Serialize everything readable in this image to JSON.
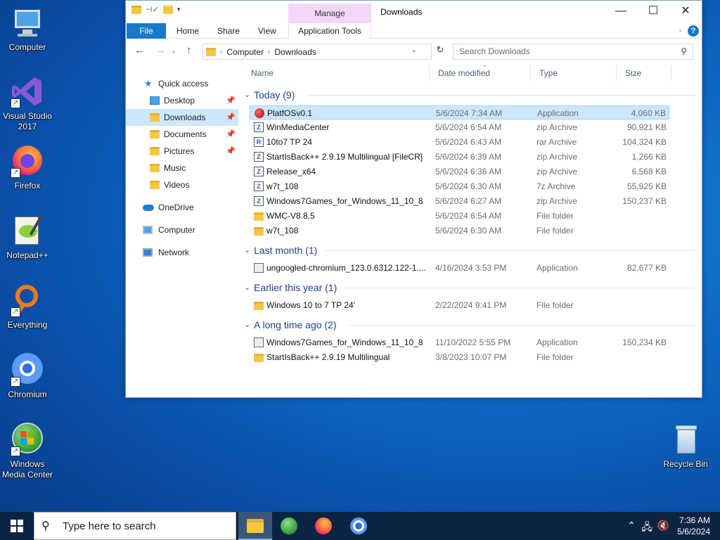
{
  "desktop": {
    "icons": [
      {
        "label": "Computer"
      },
      {
        "label": "Visual Studio 2017"
      },
      {
        "label": "Firefox"
      },
      {
        "label": "Notepad++"
      },
      {
        "label": "Everything"
      },
      {
        "label": "Chromium"
      },
      {
        "label": "Windows Media Center"
      },
      {
        "label": "Recycle Bin"
      }
    ]
  },
  "window": {
    "title": "Downloads",
    "manage_label": "Manage",
    "ribbon_tabs": {
      "file": "File",
      "home": "Home",
      "share": "Share",
      "view": "View",
      "app_tools": "Application Tools"
    },
    "address": {
      "seg1": "Computer",
      "seg2": "Downloads"
    },
    "search_placeholder": "Search Downloads",
    "nav": {
      "quick_access": "Quick access",
      "desktop": "Desktop",
      "downloads": "Downloads",
      "documents": "Documents",
      "pictures": "Pictures",
      "music": "Music",
      "videos": "Videos",
      "onedrive": "OneDrive",
      "computer": "Computer",
      "network": "Network"
    },
    "columns": {
      "name": "Name",
      "date": "Date modified",
      "type": "Type",
      "size": "Size"
    },
    "groups": [
      {
        "title": "Today (9)",
        "rows": [
          {
            "name": "PlatfOSv0.1",
            "date": "5/6/2024 7:34 AM",
            "type": "Application",
            "size": "4,060 KB"
          },
          {
            "name": "WinMediaCenter",
            "date": "5/6/2024 6:54 AM",
            "type": "zip Archive",
            "size": "90,921 KB"
          },
          {
            "name": "10to7 TP 24",
            "date": "5/6/2024 6:43 AM",
            "type": "rar Archive",
            "size": "104,324 KB"
          },
          {
            "name": "StartIsBack++ 2.9.19 Multilingual [FileCR]",
            "date": "5/6/2024 6:39 AM",
            "type": "zip Archive",
            "size": "1,266 KB"
          },
          {
            "name": "Release_x64",
            "date": "5/6/2024 6:36 AM",
            "type": "zip Archive",
            "size": "6,568 KB"
          },
          {
            "name": "w7t_108",
            "date": "5/6/2024 6:30 AM",
            "type": "7z Archive",
            "size": "55,925 KB"
          },
          {
            "name": "Windows7Games_for_Windows_11_10_8",
            "date": "5/6/2024 6:27 AM",
            "type": "zip Archive",
            "size": "150,237 KB"
          },
          {
            "name": "WMC-V8.8.5",
            "date": "5/6/2024 6:54 AM",
            "type": "File folder",
            "size": ""
          },
          {
            "name": "w7t_108",
            "date": "5/6/2024 6:30 AM",
            "type": "File folder",
            "size": ""
          }
        ]
      },
      {
        "title": "Last month (1)",
        "rows": [
          {
            "name": "ungoogled-chromium_123.0.6312.122-1....",
            "date": "4/16/2024 3:53 PM",
            "type": "Application",
            "size": "82,677 KB"
          }
        ]
      },
      {
        "title": "Earlier this year (1)",
        "rows": [
          {
            "name": "Windows 10 to 7 TP 24'",
            "date": "2/22/2024 9:41 PM",
            "type": "File folder",
            "size": ""
          }
        ]
      },
      {
        "title": "A long time ago (2)",
        "rows": [
          {
            "name": "Windows7Games_for_Windows_11_10_8",
            "date": "11/10/2022 5:55 PM",
            "type": "Application",
            "size": "150,234 KB"
          },
          {
            "name": "StartIsBack++ 2.9.19 Multilingual",
            "date": "3/8/2023 10:07 PM",
            "type": "File folder",
            "size": ""
          }
        ]
      }
    ]
  },
  "taskbar": {
    "search_placeholder": "Type here to search",
    "time": "7:36 AM",
    "date": "5/6/2024"
  }
}
